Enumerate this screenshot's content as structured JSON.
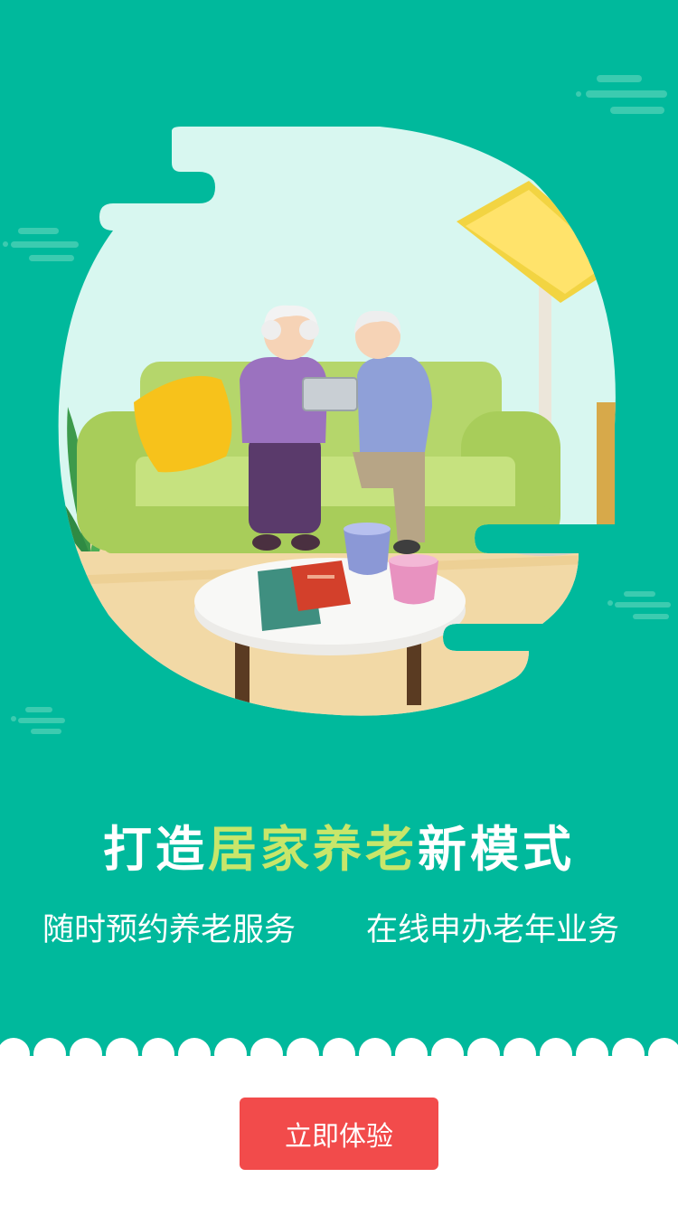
{
  "colors": {
    "background_green": "#00b99c",
    "accent_green": "#c8e66a",
    "cta_red": "#f24b4b",
    "white": "#ffffff"
  },
  "illustration": {
    "subject": "elderly-couple-on-sofa-with-tablet",
    "icons": [
      "cloud-icon",
      "lamp-icon",
      "plant-icon",
      "cup-icon",
      "book-icon"
    ]
  },
  "headline": {
    "part1": "打造",
    "highlight": "居家养老",
    "part2": "新模式"
  },
  "features": {
    "left": "随时预约养老服务",
    "right": "在线申办老年业务"
  },
  "cta": {
    "label": "立即体验"
  }
}
